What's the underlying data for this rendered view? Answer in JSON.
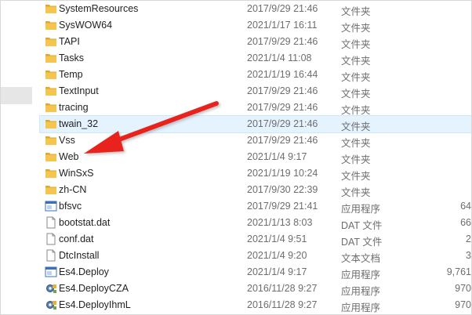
{
  "rows": [
    {
      "icon": "folder-icon",
      "name": "SystemResources",
      "date": "2017/9/29 21:46",
      "type": "文件夹",
      "size": ""
    },
    {
      "icon": "folder-icon",
      "name": "SysWOW64",
      "date": "2021/1/17 16:11",
      "type": "文件夹",
      "size": ""
    },
    {
      "icon": "folder-icon",
      "name": "TAPI",
      "date": "2017/9/29 21:46",
      "type": "文件夹",
      "size": ""
    },
    {
      "icon": "folder-icon",
      "name": "Tasks",
      "date": "2021/1/4 11:08",
      "type": "文件夹",
      "size": ""
    },
    {
      "icon": "folder-icon",
      "name": "Temp",
      "date": "2021/1/19 16:44",
      "type": "文件夹",
      "size": ""
    },
    {
      "icon": "folder-icon",
      "name": "TextInput",
      "date": "2017/9/29 21:46",
      "type": "文件夹",
      "size": ""
    },
    {
      "icon": "folder-icon",
      "name": "tracing",
      "date": "2017/9/29 21:46",
      "type": "文件夹",
      "size": ""
    },
    {
      "icon": "folder-icon",
      "name": "twain_32",
      "date": "2017/9/29 21:46",
      "type": "文件夹",
      "size": ""
    },
    {
      "icon": "folder-icon",
      "name": "Vss",
      "date": "2017/9/29 21:46",
      "type": "文件夹",
      "size": ""
    },
    {
      "icon": "folder-icon",
      "name": "Web",
      "date": "2021/1/4 9:17",
      "type": "文件夹",
      "size": ""
    },
    {
      "icon": "folder-icon",
      "name": "WinSxS",
      "date": "2021/1/19 10:24",
      "type": "文件夹",
      "size": ""
    },
    {
      "icon": "folder-icon",
      "name": "zh-CN",
      "date": "2017/9/30 22:39",
      "type": "文件夹",
      "size": ""
    },
    {
      "icon": "application-icon",
      "name": "bfsvc",
      "date": "2017/9/29 21:41",
      "type": "应用程序",
      "size": "64"
    },
    {
      "icon": "file-icon",
      "name": "bootstat.dat",
      "date": "2021/1/13 8:03",
      "type": "DAT 文件",
      "size": "66"
    },
    {
      "icon": "file-icon",
      "name": "conf.dat",
      "date": "2021/1/4 9:51",
      "type": "DAT 文件",
      "size": "2"
    },
    {
      "icon": "file-icon",
      "name": "DtcInstall",
      "date": "2021/1/4 9:20",
      "type": "文本文档",
      "size": "3"
    },
    {
      "icon": "application-icon",
      "name": "Es4.Deploy",
      "date": "2021/1/4 9:17",
      "type": "应用程序",
      "size": "9,761"
    },
    {
      "icon": "gear-app-icon",
      "name": "Es4.DeployCZA",
      "date": "2016/11/28 9:27",
      "type": "应用程序",
      "size": "970"
    },
    {
      "icon": "gear-app-icon",
      "name": "Es4.DeployIhmL",
      "date": "2016/11/28 9:27",
      "type": "应用程序",
      "size": "970"
    }
  ],
  "colors": {
    "folder": "#f4c64f",
    "folder_dark": "#e0a82e",
    "arrow": "#e8221b",
    "hover": "#e5f3ff"
  }
}
